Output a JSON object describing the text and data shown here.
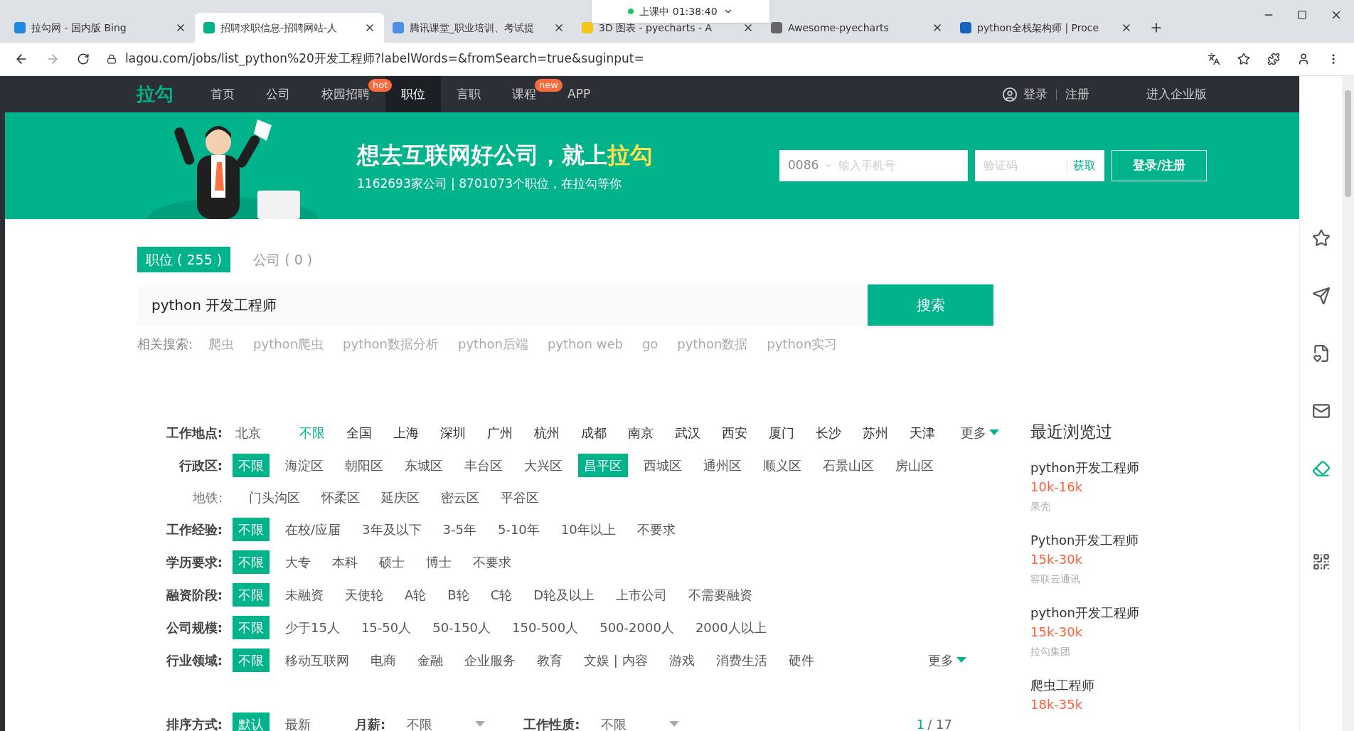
{
  "browser": {
    "tabs": [
      {
        "title": "拉勾网 - 国内版 Bing",
        "selected": false,
        "color": "#1e88e5"
      },
      {
        "title": "招聘求职信息-招聘网站-人",
        "selected": true,
        "color": "#00b38a"
      },
      {
        "title": "腾讯课堂_职业培训、考试提",
        "selected": false,
        "color": "#4a90e2"
      },
      {
        "title": "3D 图表 - pyecharts - A",
        "selected": false,
        "color": "#f5c518"
      },
      {
        "title": "Awesome-pyecharts",
        "selected": false,
        "color": "#666666"
      },
      {
        "title": "python全栈架构师 | Proce",
        "selected": false,
        "color": "#1565c0"
      }
    ],
    "address": "lagou.com/jobs/list_python%20开发工程师?labelWords=&fromSearch=true&suginput=",
    "timer": "上课中 01:38:40"
  },
  "nav": {
    "logo": "拉勾",
    "items": [
      {
        "label": "首页",
        "selected": false
      },
      {
        "label": "公司",
        "selected": false
      },
      {
        "label": "校园招聘",
        "selected": false,
        "badge": "hot"
      },
      {
        "label": "职位",
        "selected": true
      },
      {
        "label": "言职",
        "selected": false
      },
      {
        "label": "课程",
        "selected": false,
        "badge": "new"
      },
      {
        "label": "APP",
        "selected": false
      }
    ],
    "login": "登录",
    "register": "注册",
    "enterprise": "进入企业版"
  },
  "banner": {
    "headline": "想去互联网好公司，就上",
    "headline_highlight": "拉勾",
    "stats": "1162693家公司 | 8701073个职位，在拉勾等你",
    "phone_code": "0086",
    "phone_placeholder": "输入手机号",
    "code_placeholder": "验证码",
    "get_code": "获取",
    "submit": "登录/注册"
  },
  "search_tabs": [
    {
      "label": "职位 ( 255 )",
      "selected": true
    },
    {
      "label": "公司 ( 0 )",
      "selected": false
    }
  ],
  "search": {
    "value": "python 开发工程师",
    "button": "搜索"
  },
  "related": {
    "label": "相关搜索:",
    "items": [
      "爬虫",
      "python爬虫",
      "python数据分析",
      "python后端",
      "python web",
      "go",
      "python数据",
      "python实习"
    ]
  },
  "filters": [
    {
      "kind": "city",
      "label": "工作地点:",
      "current": "北京",
      "more": "更多",
      "options": [
        {
          "label": "不限",
          "selected": true
        },
        {
          "label": "全国",
          "selected": false
        },
        {
          "label": "上海",
          "selected": false
        },
        {
          "label": "深圳",
          "selected": false
        },
        {
          "label": "广州",
          "selected": false
        },
        {
          "label": "杭州",
          "selected": false
        },
        {
          "label": "成都",
          "selected": false
        },
        {
          "label": "南京",
          "selected": false
        },
        {
          "label": "武汉",
          "selected": false
        },
        {
          "label": "西安",
          "selected": false
        },
        {
          "label": "厦门",
          "selected": false
        },
        {
          "label": "长沙",
          "selected": false
        },
        {
          "label": "苏州",
          "selected": false
        },
        {
          "label": "天津",
          "selected": false
        }
      ]
    },
    {
      "kind": "chips",
      "label": "行政区:",
      "options": [
        {
          "label": "不限",
          "selected": true
        },
        {
          "label": "海淀区",
          "selected": false
        },
        {
          "label": "朝阳区",
          "selected": false
        },
        {
          "label": "东城区",
          "selected": false
        },
        {
          "label": "丰台区",
          "selected": false
        },
        {
          "label": "大兴区",
          "selected": false
        },
        {
          "label": "昌平区",
          "selected": true
        },
        {
          "label": "西城区",
          "selected": false
        },
        {
          "label": "通州区",
          "selected": false
        },
        {
          "label": "顺义区",
          "selected": false
        },
        {
          "label": "石景山区",
          "selected": false
        },
        {
          "label": "房山区",
          "selected": false
        }
      ]
    },
    {
      "kind": "sub",
      "label": "地铁:",
      "options": [
        {
          "label": "门头沟区",
          "selected": false
        },
        {
          "label": "怀柔区",
          "selected": false
        },
        {
          "label": "延庆区",
          "selected": false
        },
        {
          "label": "密云区",
          "selected": false
        },
        {
          "label": "平谷区",
          "selected": false
        }
      ]
    },
    {
      "kind": "chips",
      "label": "工作经验:",
      "options": [
        {
          "label": "不限",
          "selected": true
        },
        {
          "label": "在校/应届",
          "selected": false
        },
        {
          "label": "3年及以下",
          "selected": false
        },
        {
          "label": "3-5年",
          "selected": false
        },
        {
          "label": "5-10年",
          "selected": false
        },
        {
          "label": "10年以上",
          "selected": false
        },
        {
          "label": "不要求",
          "selected": false
        }
      ]
    },
    {
      "kind": "chips",
      "label": "学历要求:",
      "options": [
        {
          "label": "不限",
          "selected": true
        },
        {
          "label": "大专",
          "selected": false
        },
        {
          "label": "本科",
          "selected": false
        },
        {
          "label": "硕士",
          "selected": false
        },
        {
          "label": "博士",
          "selected": false
        },
        {
          "label": "不要求",
          "selected": false
        }
      ]
    },
    {
      "kind": "chips",
      "label": "融资阶段:",
      "options": [
        {
          "label": "不限",
          "selected": true
        },
        {
          "label": "未融资",
          "selected": false
        },
        {
          "label": "天使轮",
          "selected": false
        },
        {
          "label": "A轮",
          "selected": false
        },
        {
          "label": "B轮",
          "selected": false
        },
        {
          "label": "C轮",
          "selected": false
        },
        {
          "label": "D轮及以上",
          "selected": false
        },
        {
          "label": "上市公司",
          "selected": false
        },
        {
          "label": "不需要融资",
          "selected": false
        }
      ]
    },
    {
      "kind": "chips",
      "label": "公司规模:",
      "options": [
        {
          "label": "不限",
          "selected": true
        },
        {
          "label": "少于15人",
          "selected": false
        },
        {
          "label": "15-50人",
          "selected": false
        },
        {
          "label": "50-150人",
          "selected": false
        },
        {
          "label": "150-500人",
          "selected": false
        },
        {
          "label": "500-2000人",
          "selected": false
        },
        {
          "label": "2000人以上",
          "selected": false
        }
      ]
    },
    {
      "kind": "chips",
      "label": "行业领域:",
      "more": "更多",
      "options": [
        {
          "label": "不限",
          "selected": true
        },
        {
          "label": "移动互联网",
          "selected": false
        },
        {
          "label": "电商",
          "selected": false
        },
        {
          "label": "金融",
          "selected": false
        },
        {
          "label": "企业服务",
          "selected": false
        },
        {
          "label": "教育",
          "selected": false
        },
        {
          "label": "文娱 | 内容",
          "selected": false
        },
        {
          "label": "游戏",
          "selected": false
        },
        {
          "label": "消费生活",
          "selected": false
        },
        {
          "label": "硬件",
          "selected": false
        }
      ]
    }
  ],
  "sort": {
    "label": "排序方式:",
    "options": [
      {
        "label": "默认",
        "selected": true
      },
      {
        "label": "最新",
        "selected": false
      }
    ],
    "dropdowns": [
      {
        "label": "月薪:",
        "value": "不限"
      },
      {
        "label": "工作性质:",
        "value": "不限"
      }
    ],
    "current_page": "1",
    "total_pages": "/ 17"
  },
  "recent": {
    "title": "最近浏览过",
    "items": [
      {
        "title": "python开发工程师",
        "salary": "10k-16k",
        "company": "果壳"
      },
      {
        "title": "Python开发工程师",
        "salary": "15k-30k",
        "company": "容联云通讯"
      },
      {
        "title": "python开发工程师",
        "salary": "15k-30k",
        "company": "拉勾集团"
      },
      {
        "title": "爬虫工程师",
        "salary": "18k-35k"
      }
    ]
  }
}
